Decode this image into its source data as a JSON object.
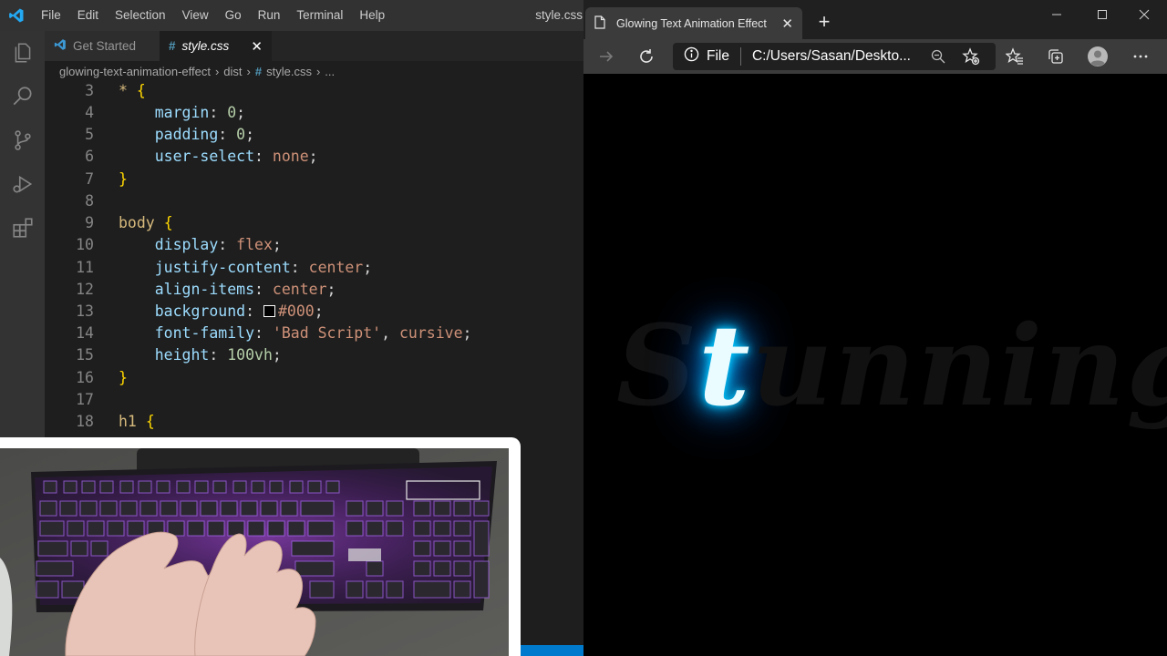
{
  "vscode": {
    "menu": [
      "File",
      "Edit",
      "Selection",
      "View",
      "Go",
      "Run",
      "Terminal",
      "Help"
    ],
    "window_title": "style.css",
    "tabs": [
      {
        "label": "Get Started"
      },
      {
        "label": "style.css",
        "close": "✕"
      }
    ],
    "breadcrumb": {
      "folder": "glowing-text-animation-effect",
      "subfolder": "dist",
      "file": "style.css",
      "more": "..."
    },
    "code": {
      "lines": {
        "l3": {
          "n": "3",
          "sel": "*",
          "brace": "{"
        },
        "l4": {
          "n": "4",
          "prop": "margin",
          "val": "0"
        },
        "l5": {
          "n": "5",
          "prop": "padding",
          "val": "0"
        },
        "l6": {
          "n": "6",
          "prop": "user-select",
          "val": "none"
        },
        "l7": {
          "n": "7",
          "brace": "}"
        },
        "l8": {
          "n": "8"
        },
        "l9": {
          "n": "9",
          "sel": "body",
          "brace": "{"
        },
        "l10": {
          "n": "10",
          "prop": "display",
          "val": "flex"
        },
        "l11": {
          "n": "11",
          "prop": "justify-content",
          "val": "center"
        },
        "l12": {
          "n": "12",
          "prop": "align-items",
          "val": "center"
        },
        "l13": {
          "n": "13",
          "prop": "background",
          "val": "#000"
        },
        "l14": {
          "n": "14",
          "prop": "font-family",
          "val": "'Bad Script'",
          "val2": "cursive"
        },
        "l15": {
          "n": "15",
          "prop": "height",
          "val": "100vh"
        },
        "l16": {
          "n": "16",
          "brace": "}"
        },
        "l17": {
          "n": "17"
        },
        "l18": {
          "n": "18",
          "sel": "h1",
          "brace": "{"
        }
      }
    }
  },
  "browser": {
    "tab_title": "Glowing Text Animation Effect",
    "tab_close": "✕",
    "new_tab": "+",
    "address": {
      "scheme": "File",
      "url": "C:/Users/Sasan/Deskto..."
    },
    "glow_letters": [
      "S",
      "t",
      "u",
      "n",
      "n",
      "i",
      "n",
      "g"
    ],
    "lit_index": 1
  },
  "colors": {
    "vscode_bg": "#1e1e1e",
    "activity_bar": "#333333",
    "title_bar": "#323233",
    "accent_blue": "#007acc",
    "glow": "#00c8ff"
  }
}
